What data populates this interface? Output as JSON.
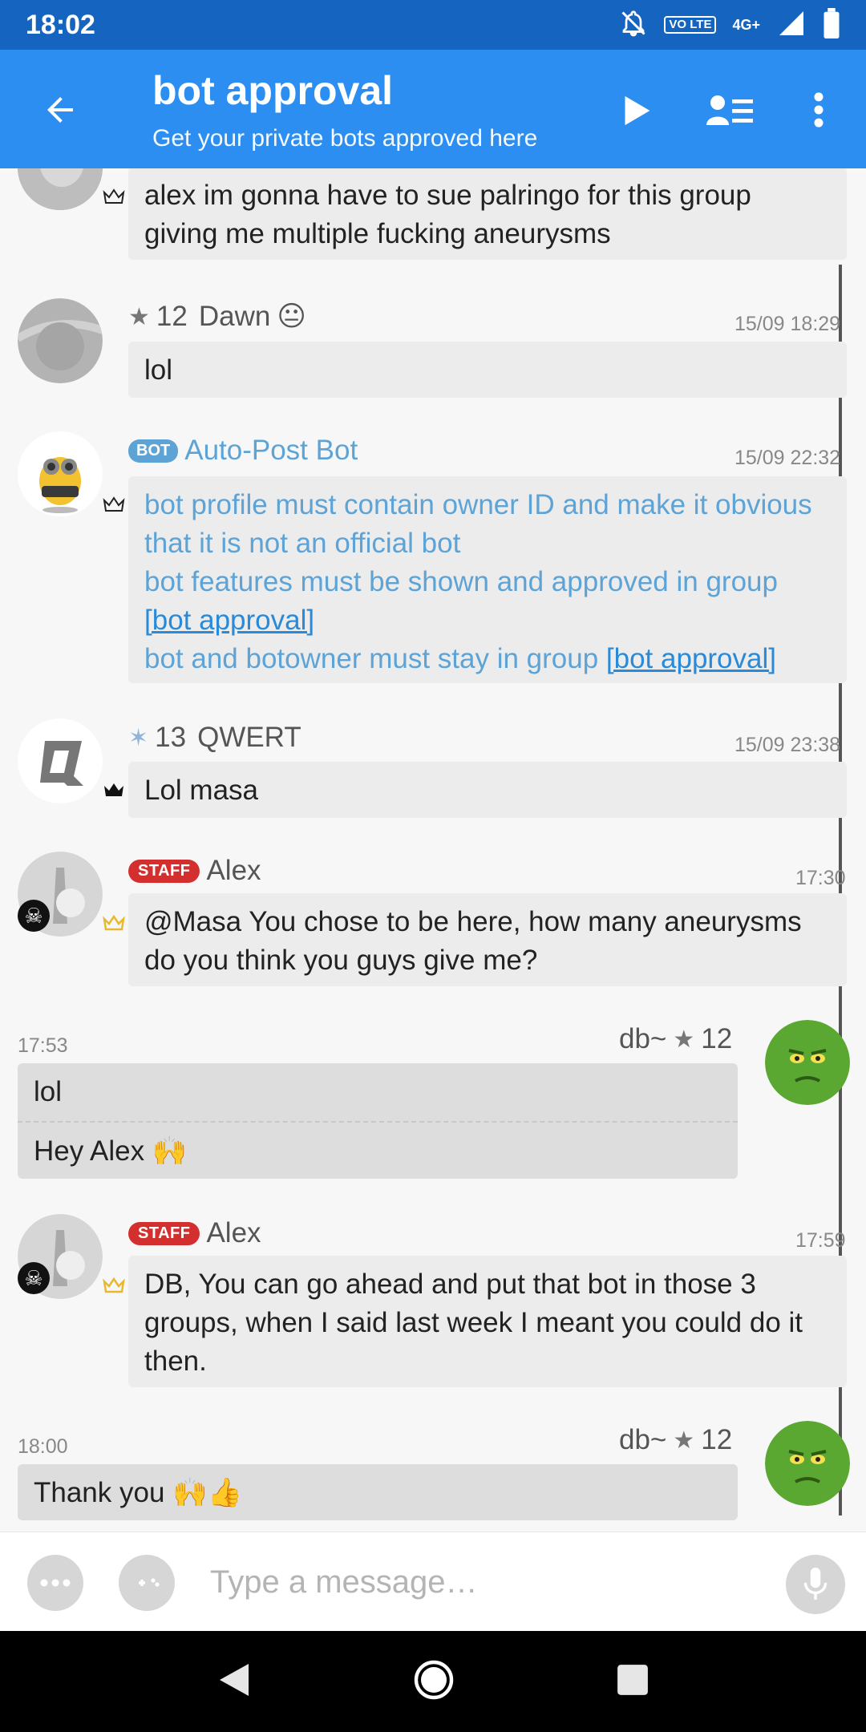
{
  "status_bar": {
    "time": "18:02",
    "volte": "VO LTE",
    "network": "4G+"
  },
  "header": {
    "title": "bot approval",
    "subtitle": "Get your private bots approved here"
  },
  "messages": [
    {
      "body": "alex im gonna have to sue palringo for this group giving me multiple fucking aneurysms"
    },
    {
      "reputation": "12",
      "name": "Dawn",
      "emoji": "😐",
      "time": "15/09 18:29",
      "body": "lol"
    },
    {
      "badge": "BOT",
      "name": "Auto-Post Bot",
      "time": "15/09 22:32",
      "lines": [
        "bot profile must contain owner ID and make it obvious that it is not an official bot",
        "bot features must be shown and approved in group",
        "[bot approval]",
        "bot and botowner must stay in group",
        "[bot approval]"
      ]
    },
    {
      "reputation": "13",
      "name": "QWERT",
      "time": "15/09 23:38",
      "body": "Lol masa"
    },
    {
      "badge": "STAFF",
      "name": "Alex",
      "time": "17:30",
      "body": "@Masa You chose to be here, how many aneurysms do you think you guys give me?"
    },
    {
      "name": "db~",
      "reputation": "12",
      "time": "17:53",
      "body1": "lol",
      "body2": "Hey Alex 🙌"
    },
    {
      "badge": "STAFF",
      "name": "Alex",
      "time": "17:59",
      "body": "DB, You can go ahead and put that bot in those 3 groups, when I said last week I meant you could do it then."
    },
    {
      "name": "db~",
      "reputation": "12",
      "time": "18:00",
      "body": "Thank you 🙌👍"
    }
  ],
  "input": {
    "placeholder": "Type a message…"
  },
  "colors": {
    "status_bar": "#1565c0",
    "app_bar": "#2b8ef0",
    "staff_badge": "#d32f2f",
    "bot_text": "#5da3d6"
  }
}
